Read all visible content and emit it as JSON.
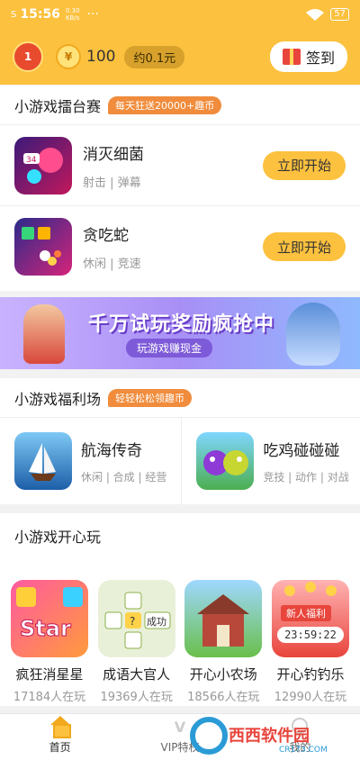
{
  "status": {
    "time": "15:56",
    "net_speed": "0.30\nKB/s",
    "dots": "···",
    "battery": "57"
  },
  "header": {
    "redpack_badge": "1",
    "coins": "100",
    "approx_value": "约0.1元",
    "checkin_label": "签到"
  },
  "arena": {
    "title": "小游戏擂台赛",
    "tag": "每天狂送20000+趣币",
    "games": [
      {
        "name": "消灭细菌",
        "tags": "射击 | 弹幕",
        "button": "立即开始"
      },
      {
        "name": "贪吃蛇",
        "tags": "休闲 | 竞速",
        "button": "立即开始"
      }
    ]
  },
  "banner": {
    "title": "千万试玩奖励疯抢中",
    "subtitle": "玩游戏赚现金"
  },
  "welfare": {
    "title": "小游戏福利场",
    "tag": "轻轻松松领趣币",
    "games": [
      {
        "name": "航海传奇",
        "tags": "休闲 | 合成 | 经营"
      },
      {
        "name": "吃鸡碰碰碰",
        "tags": "竞技 | 动作 | 对战"
      }
    ]
  },
  "fun": {
    "title": "小游戏开心玩",
    "games": [
      {
        "name": "疯狂消星星",
        "count": "17184人在玩",
        "art": "Star"
      },
      {
        "name": "成语大官人",
        "count": "19369人在玩",
        "art": "成功"
      },
      {
        "name": "开心小农场",
        "count": "18566人在玩"
      },
      {
        "name": "开心钓钓乐",
        "count": "12990人在玩",
        "badge": "新人福利",
        "timer": "23:59:22"
      }
    ]
  },
  "tabs": [
    {
      "label": "首页"
    },
    {
      "label": "VIP特权"
    },
    {
      "label": "我的"
    }
  ],
  "watermark": {
    "text": "西西软件园",
    "sub": "CR173.COM"
  },
  "colors": {
    "accent": "#fcc13e",
    "tag": "#f08c3c",
    "text": "#222222"
  }
}
